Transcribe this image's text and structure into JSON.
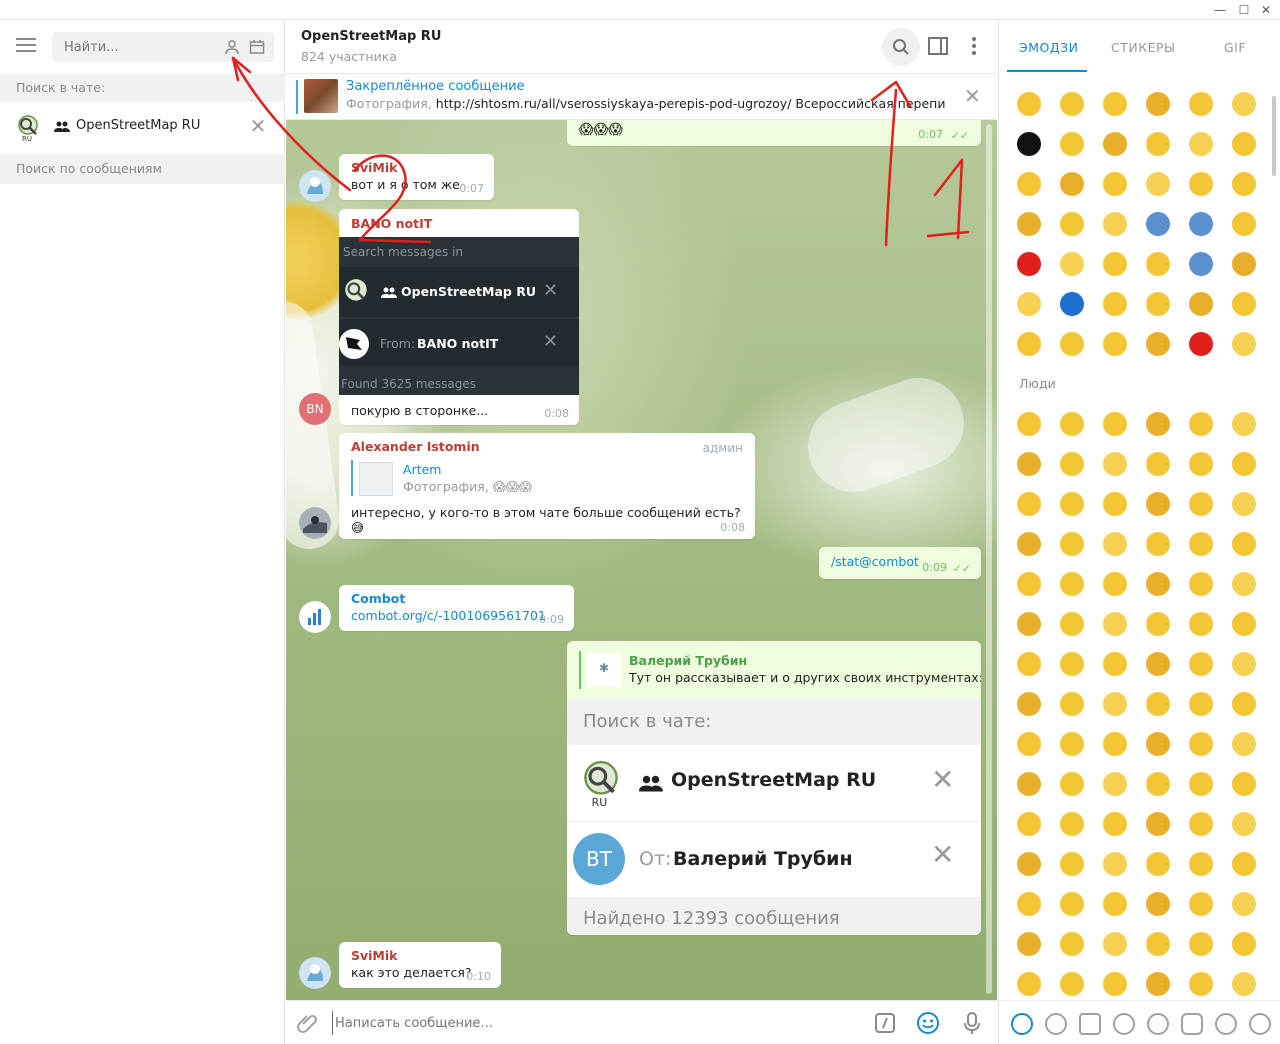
{
  "left_panel": {
    "search_placeholder": "Найти...",
    "in_chat_label": "Поиск в чате:",
    "chat_filter_name": "OpenStreetMap RU",
    "msg_search_label": "Поиск по сообщениям"
  },
  "header": {
    "title": "OpenStreetMap RU",
    "subtitle": "824 участника"
  },
  "pinned": {
    "title": "Закреплённое сообщение",
    "prefix": "Фотография,",
    "text": "http://shtosm.ru/all/vserossiyskaya-perepis-pod-ugrozoy/ Всероссийская перепись по..."
  },
  "messages": {
    "top_emojis": "😱😱😱",
    "top_time": "0:07",
    "m1_sender": "SviMik",
    "m1_text": "вот и я о том же",
    "m1_time": "0:07",
    "m2_sender": "BANO notIT",
    "m2_search_placeholder": "Search messages in",
    "m2_chat_name": "OpenStreetMap RU",
    "m2_from_label": "From:",
    "m2_from_name": "BANO notIT",
    "m2_found": "Found 3625 messages",
    "m2_text": "покурю в сторонке...",
    "m2_time": "0:08",
    "m2_avatar": "BN",
    "m3_sender": "Alexander Istomin",
    "m3_badge": "админ",
    "m3_reply_name": "Artem",
    "m3_reply_text": "Фотография,",
    "m3_reply_emojis": "😱😱😱",
    "m3_text": "интересно, у кого-то в этом чате больше сообщений есть? 😅",
    "m3_time": "0:08",
    "m4_text": "/stat@combot",
    "m4_time": "0:09",
    "m5_sender": "Combot",
    "m5_link": "combot.org/c/-1001069561701",
    "m5_time": "0:09",
    "m6_reply_name": "Валерий Трубин",
    "m6_reply_text": "Тут он рассказывает и о других своих инструментах: h...",
    "m6_search_label": "Поиск в чате:",
    "m6_chat_name": "OpenStreetMap RU",
    "m6_avatar": "BT",
    "m6_from_label": "От:",
    "m6_from_name": "Валерий Трубин",
    "m6_found": "Найдено 12393 сообщения",
    "m7_sender": "SviMik",
    "m7_text": "как это делается?",
    "m7_time": "0:10"
  },
  "composer": {
    "placeholder": "Написать сообщение..."
  },
  "emoji_panel": {
    "tabs": [
      "ЭМОДЗИ",
      "СТИКЕРЫ",
      "GIF"
    ],
    "people_label": "Люди"
  },
  "annotations": {
    "mark_1": "1",
    "mark_2": "2"
  },
  "colors": {
    "accent": "#168acd",
    "sender_red": "#c03d33",
    "outgoing_bubble": "#effdde",
    "annotation_red": "#e0201c"
  }
}
